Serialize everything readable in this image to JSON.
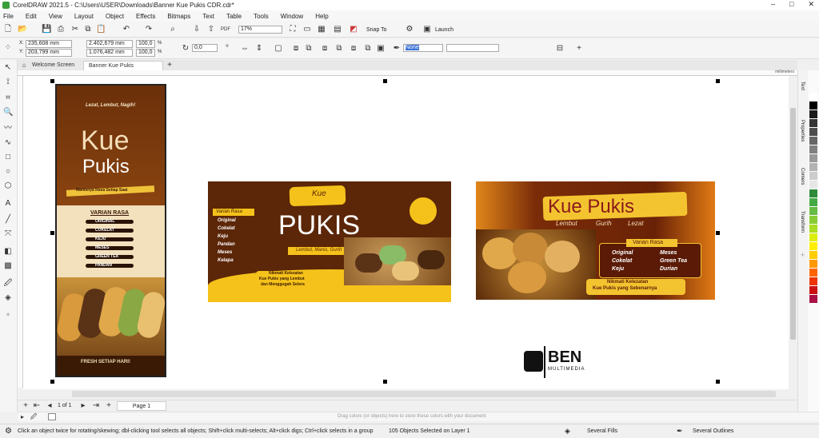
{
  "app": {
    "title": "CorelDRAW 2021.5 - C:\\Users\\USER\\Downloads\\Banner Kue Pukis CDR.cdr*",
    "window_min": "–",
    "window_max": "□",
    "window_close": "✕"
  },
  "menu": [
    "File",
    "Edit",
    "View",
    "Layout",
    "Object",
    "Effects",
    "Bitmaps",
    "Text",
    "Table",
    "Tools",
    "Window",
    "Help"
  ],
  "toolbar": {
    "zoom": "17%",
    "snap": "Snap To",
    "launch": "Launch"
  },
  "propbar": {
    "x": "235,608 mm",
    "y": "203,799 mm",
    "w": "2.402,679 mm",
    "h": "1.076,482 mm",
    "sx": "100,0",
    "sy": "100,0",
    "pct": "%",
    "angle": "0,0",
    "outline": "None"
  },
  "tabs": {
    "welcome": "Welcome Screen",
    "doc": "Banner Kue Pukis CDR.cdr*",
    "ruler_unit": "millimeters"
  },
  "dock": {
    "text": "Text",
    "properties": "Properties",
    "corners": "Corners",
    "transform": "Transform"
  },
  "pagebar": {
    "counter": "1 of 1",
    "page": "Page 1"
  },
  "dropbar": "Drag colors (or objects) here to store these colors with your document",
  "status": {
    "hint": "Click an object twice for rotating/skewing; dbl-clicking tool selects all objects; Shift+click multi-selects; Alt+click digs; Ctrl+click selects in a group",
    "selection": "105 Objects Selected on Layer 1",
    "fills": "Several Fills",
    "outlines": "Several Outlines"
  },
  "banner_vertical": {
    "tagline": "Lezat, Lembut, Nagih!",
    "title1": "Kue",
    "title2": "Pukis",
    "sub": "Manisnya Rasa Setiap Saat",
    "menu_title": "VARIAN RASA",
    "items": [
      "ORIGINAL",
      "COKELAT",
      "KEJU",
      "MESES",
      "GREEN TEA",
      "PANDAN"
    ],
    "footer": "FRESH SETIAP HARI!"
  },
  "banner_mid": {
    "kue": "Kue",
    "pukis": "PUKIS",
    "tagline": "Lembut, Manis, Gurih",
    "menu_title": "Varian Rasa",
    "items": [
      "Original",
      "Cokelat",
      "Keju",
      "Pandan",
      "Meses",
      "Kelapa"
    ],
    "footer1": "Nikmati Kelezatan",
    "footer2": "Kue Pukis yang Lembut",
    "footer3": "dan Menggugah Selera"
  },
  "banner_right": {
    "title": "Kue Pukis",
    "sub1": "Lembut",
    "sub2": "Gurih",
    "sub3": "Lezat",
    "menu_title": "Varian Rasa",
    "items": [
      "Original",
      "Cokelat",
      "Keju",
      "Meses",
      "Green Tea",
      "Durian"
    ],
    "footer1": "Nikmati Kelezatan",
    "footer2": "Kue Pukis yang Sebenarnya"
  },
  "logo": {
    "name": "BEN",
    "sub": "MULTIMEDIA"
  },
  "palette": [
    "#ffffff",
    "#000000",
    "#1a1a1a",
    "#333333",
    "#4d4d4d",
    "#666666",
    "#808080",
    "#999999",
    "#b3b3b3",
    "#cccccc",
    "#e6e6e6",
    "#2e8b3a",
    "#44aa44",
    "#66bb44",
    "#88cc33",
    "#aadd22",
    "#ddee11",
    "#ffee00",
    "#ffcc00",
    "#ff9900",
    "#ff6600",
    "#ee3300",
    "#cc1111",
    "#aa1144"
  ]
}
